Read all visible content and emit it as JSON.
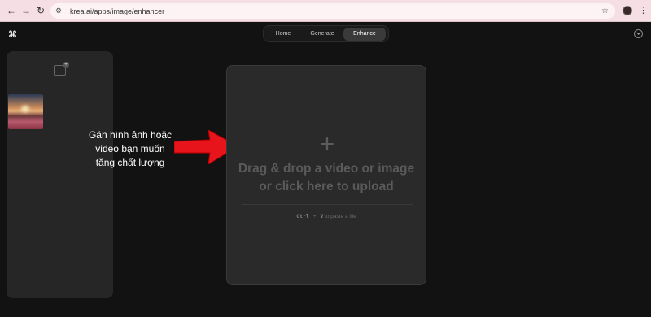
{
  "browser": {
    "url": "krea.ai/apps/image/enhancer",
    "back_icon": "arrow-left",
    "forward_icon": "arrow-right",
    "reload_icon": "reload",
    "star_icon": "star"
  },
  "app": {
    "tabs": [
      {
        "label": "Home",
        "active": false
      },
      {
        "label": "Generate",
        "active": false
      },
      {
        "label": "Enhance",
        "active": true
      }
    ]
  },
  "annotation": {
    "text_lines": [
      "Gán hình ảnh hoặc",
      "video bạn muốn",
      "tăng chất lượng"
    ],
    "arrow_color": "#e8141c"
  },
  "dropzone": {
    "title": "Drag & drop a video or image or click here to upload",
    "hint_key1": "Ctrl",
    "hint_plus": "+",
    "hint_key2": "V",
    "hint_text": "to paste a file"
  }
}
